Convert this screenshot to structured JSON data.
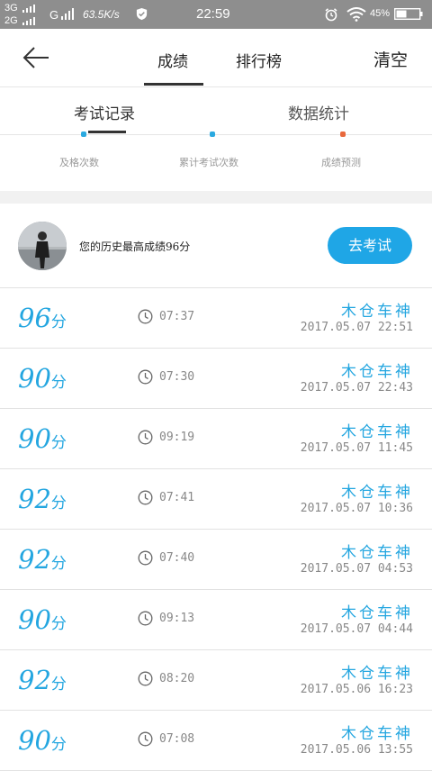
{
  "status_bar": {
    "network_1": "3G",
    "network_2": "2G",
    "network_g": "G",
    "speed": "63.5K/s",
    "time": "22:59",
    "battery": "45%"
  },
  "nav": {
    "tabs": [
      "成绩",
      "排行榜"
    ],
    "clear_label": "清空"
  },
  "sub_tabs": [
    "考试记录",
    "数据统计"
  ],
  "stats": {
    "labels": [
      "及格次数",
      "累计考试次数",
      "成绩预测"
    ],
    "mark_colors": [
      "#2aa9e0",
      "#2aa9e0",
      "#e8683c"
    ]
  },
  "best": {
    "text": "您的历史最高成绩96分",
    "button": "去考试"
  },
  "records": [
    {
      "score": "96",
      "unit": "分",
      "duration": "07:37",
      "name": "木仓车神",
      "date": "2017.05.07  22:51"
    },
    {
      "score": "90",
      "unit": "分",
      "duration": "07:30",
      "name": "木仓车神",
      "date": "2017.05.07  22:43"
    },
    {
      "score": "90",
      "unit": "分",
      "duration": "09:19",
      "name": "木仓车神",
      "date": "2017.05.07  11:45"
    },
    {
      "score": "92",
      "unit": "分",
      "duration": "07:41",
      "name": "木仓车神",
      "date": "2017.05.07  10:36"
    },
    {
      "score": "92",
      "unit": "分",
      "duration": "07:40",
      "name": "木仓车神",
      "date": "2017.05.07  04:53"
    },
    {
      "score": "90",
      "unit": "分",
      "duration": "09:13",
      "name": "木仓车神",
      "date": "2017.05.07  04:44"
    },
    {
      "score": "92",
      "unit": "分",
      "duration": "08:20",
      "name": "木仓车神",
      "date": "2017.05.06  16:23"
    },
    {
      "score": "90",
      "unit": "分",
      "duration": "07:08",
      "name": "木仓车神",
      "date": "2017.05.06  13:55"
    }
  ],
  "colors": {
    "accent": "#24a6e0",
    "button": "#1fa6e6",
    "status_bar": "#8e8e8e"
  }
}
